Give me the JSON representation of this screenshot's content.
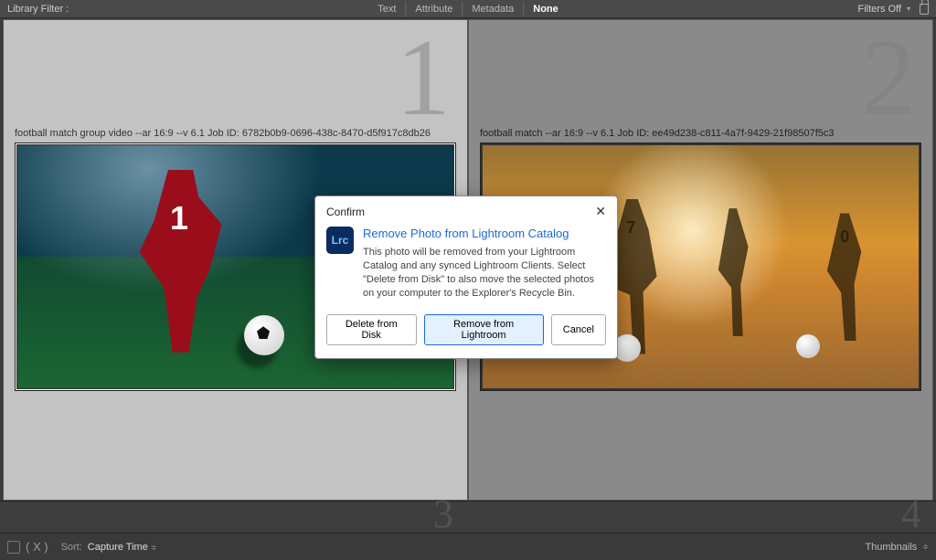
{
  "filterbar": {
    "title": "Library Filter :",
    "tabs": {
      "text": "Text",
      "attribute": "Attribute",
      "metadata": "Metadata",
      "none": "None"
    },
    "filters_off": "Filters Off"
  },
  "cells": {
    "c1": {
      "num": "1",
      "caption": "football match group video --ar 16:9 --v 6.1 Job ID: 6782b0b9-0696-438c-8470-d5f917c8db26",
      "jersey": "1"
    },
    "c2": {
      "num": "2",
      "caption": "football match --ar 16:9 --v 6.1 Job ID: ee49d238-c811-4a7f-9429-21f98507f5c3",
      "j1": "7",
      "j2": "",
      "j3": "0"
    },
    "c3": {
      "num": "3"
    },
    "c4": {
      "num": "4"
    }
  },
  "dialog": {
    "title": "Confirm",
    "app_badge": "Lrc",
    "heading": "Remove Photo from Lightroom Catalog",
    "body": "This photo will be removed from your Lightroom Catalog and any synced Lightroom Clients. Select \"Delete from Disk\" to also move the selected photos on your computer to the Explorer's Recycle Bin.",
    "delete": "Delete from Disk",
    "remove": "Remove from Lightroom",
    "cancel": "Cancel"
  },
  "toolbar": {
    "sort_label": "Sort:",
    "sort_value": "Capture Time",
    "thumbnails": "Thumbnails"
  }
}
